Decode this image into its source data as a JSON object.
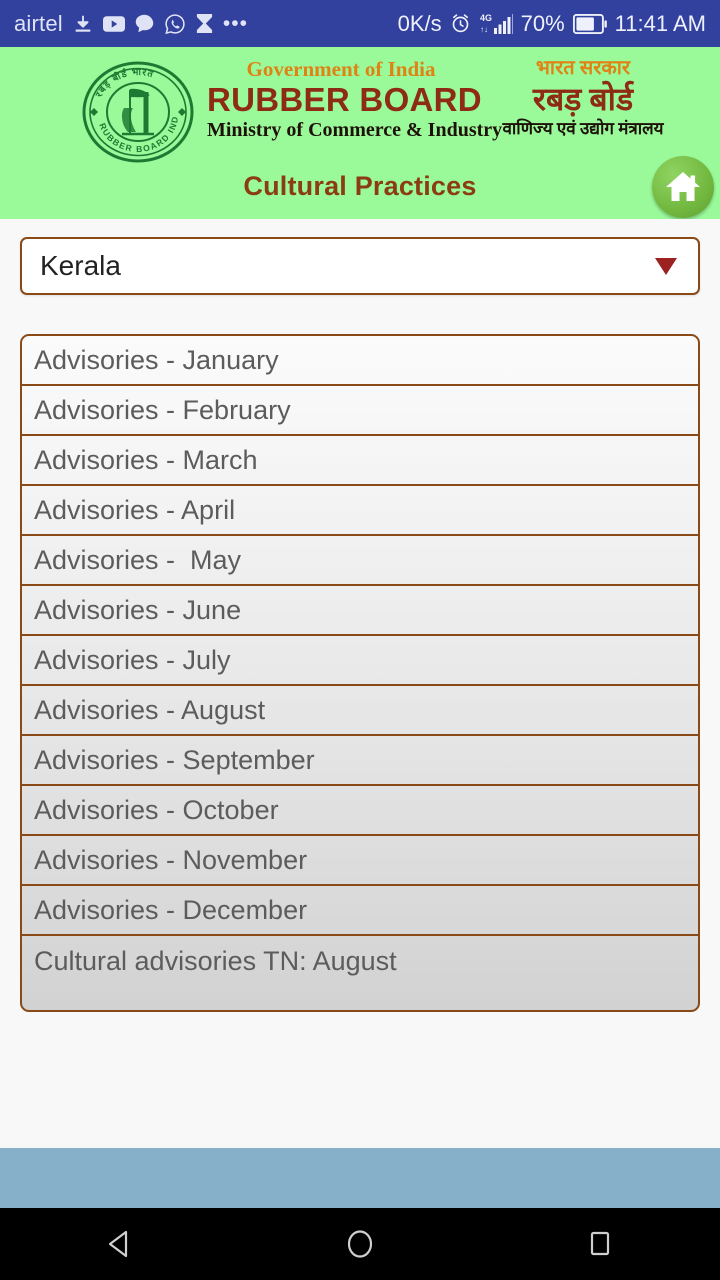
{
  "statusbar": {
    "carrier": "airtel",
    "icons_left": [
      "download-icon",
      "youtube-icon",
      "chat-bubble-icon",
      "whatsapp-icon",
      "hourglass-icon",
      "overflow-dots-icon"
    ],
    "network_speed": "0K/s",
    "alarm_icon": "alarm-clock-icon",
    "network_type": "4G",
    "signal_icon": "signal-bars-icon",
    "battery_percent": "70%",
    "battery_icon": "battery-icon",
    "clock": "11:41 AM"
  },
  "header": {
    "logo_icon": "rubber-board-emblem",
    "logo_ring_top_text": "रबड़ बोर्ड भारत",
    "logo_ring_bottom_text": "RUBBER BOARD INDIA",
    "english": {
      "line1": "Government of India",
      "line2": "RUBBER BOARD",
      "line3": "Ministry of Commerce & Industry"
    },
    "hindi": {
      "line1": "भारत सरकार",
      "line2": "रबड़ बोर्ड",
      "line3": "वाणिज्य एवं उद्योग मंत्रालय"
    },
    "page_title": "Cultural Practices",
    "home_button_icon": "home-icon",
    "bg_color": "#9afa9a",
    "title_color": "#8b3c10",
    "orange_color": "#e08214",
    "maroon_color": "#8e2b14"
  },
  "state_selector": {
    "selected": "Kerala",
    "arrow_icon": "chevron-down-icon",
    "arrow_color": "#9c2222",
    "border_color": "#8a4a18"
  },
  "advisory_list": {
    "border_color": "#8a4a18",
    "text_color": "#5c5c5c",
    "items": [
      {
        "label": "Advisories - January"
      },
      {
        "label": "Advisories - February"
      },
      {
        "label": "Advisories - March"
      },
      {
        "label": "Advisories - April"
      },
      {
        "label": "Advisories -  May"
      },
      {
        "label": "Advisories - June"
      },
      {
        "label": "Advisories - July"
      },
      {
        "label": "Advisories - August"
      },
      {
        "label": "Advisories - September"
      },
      {
        "label": "Advisories - October"
      },
      {
        "label": "Advisories - November"
      },
      {
        "label": "Advisories - December"
      },
      {
        "label": "Cultural advisories TN: August"
      }
    ]
  },
  "bottom": {
    "band_color": "#86b0c9",
    "nav": [
      {
        "icon": "back-triangle-icon"
      },
      {
        "icon": "home-circle-icon"
      },
      {
        "icon": "recents-square-icon"
      }
    ]
  }
}
